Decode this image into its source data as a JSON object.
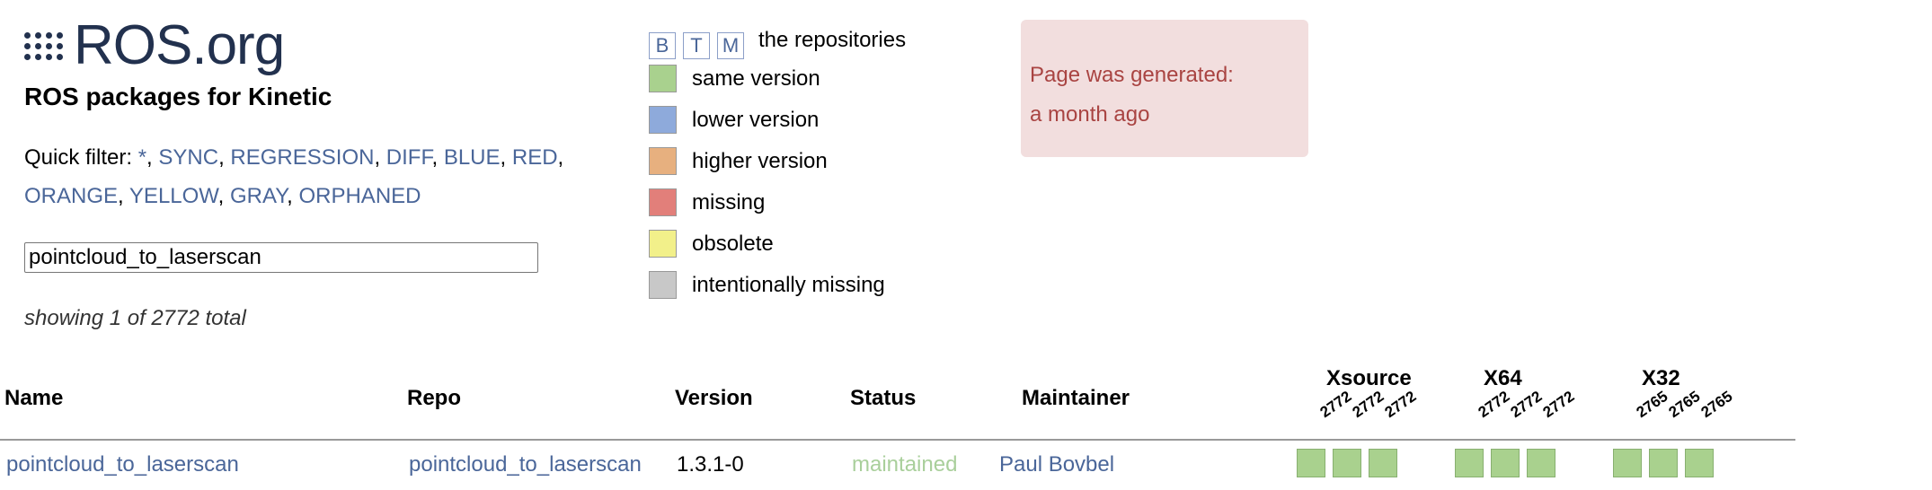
{
  "logo": {
    "text": "ROS.org"
  },
  "page_title": "ROS packages for Kinetic",
  "quick_filter": {
    "label": "Quick filter:",
    "filters": [
      "*",
      "SYNC",
      "REGRESSION",
      "DIFF",
      "BLUE",
      "RED",
      "ORANGE",
      "YELLOW",
      "GRAY",
      "ORPHANED"
    ]
  },
  "search": {
    "value": "pointcloud_to_laserscan"
  },
  "showing_text": "showing 1 of 2772 total",
  "legend": {
    "repos": [
      "B",
      "T",
      "M"
    ],
    "repos_suffix": "the repositories",
    "items": [
      {
        "label": "same version",
        "color": "#a9d18e"
      },
      {
        "label": "lower version",
        "color": "#8eaadb"
      },
      {
        "label": "higher version",
        "color": "#e7b07f"
      },
      {
        "label": "missing",
        "color": "#e27f7a"
      },
      {
        "label": "obsolete",
        "color": "#f2f08a"
      },
      {
        "label": "intentionally missing",
        "color": "#c8c8c8"
      }
    ]
  },
  "notice": {
    "line1": "Page was generated:",
    "line2": "a month ago"
  },
  "table": {
    "headers": {
      "name": "Name",
      "repo": "Repo",
      "version": "Version",
      "status": "Status",
      "maintainer": "Maintainer"
    },
    "archs": [
      {
        "name": "Xsource",
        "counts": [
          "2772",
          "2772",
          "2772"
        ]
      },
      {
        "name": "X64",
        "counts": [
          "2772",
          "2772",
          "2772"
        ]
      },
      {
        "name": "X32",
        "counts": [
          "2765",
          "2765",
          "2765"
        ]
      }
    ],
    "rows": [
      {
        "name": "pointcloud_to_laserscan",
        "repo": "pointcloud_to_laserscan",
        "version": "1.3.1-0",
        "status": "maintained",
        "maintainer": "Paul Bovbel",
        "cells": [
          "same",
          "same",
          "same",
          "same",
          "same",
          "same",
          "same",
          "same",
          "same"
        ]
      }
    ]
  }
}
